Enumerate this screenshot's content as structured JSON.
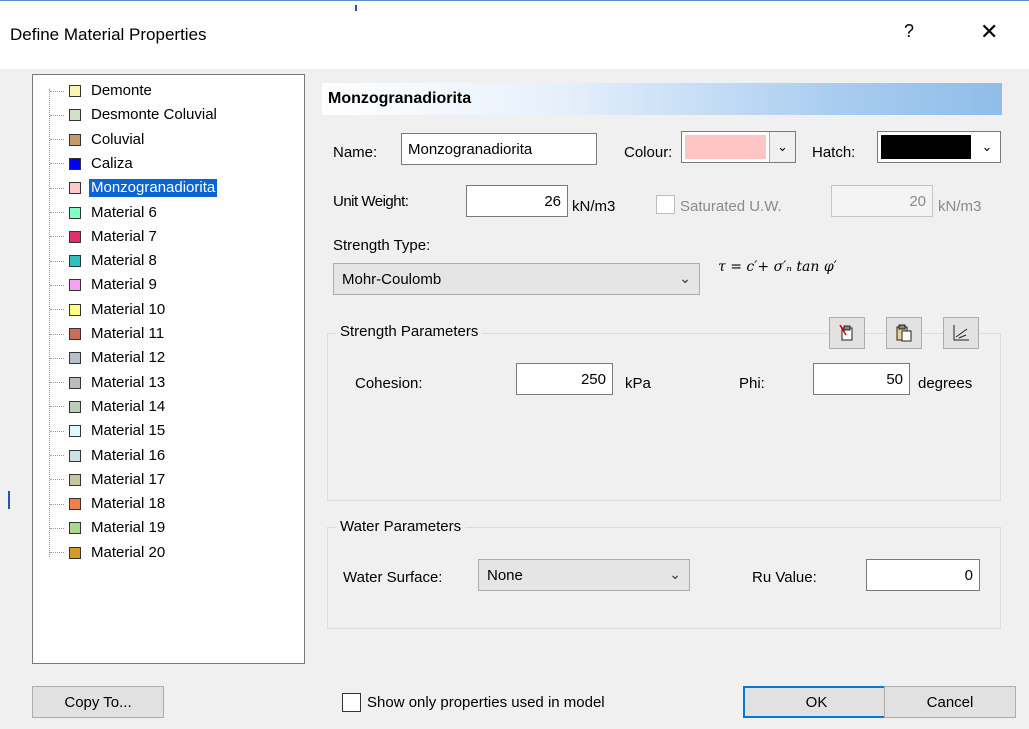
{
  "window": {
    "title": "Define Material Properties",
    "help_glyph": "?",
    "close_glyph": "✕"
  },
  "tree": {
    "items": [
      {
        "label": "Demonte",
        "color": "#fbf5b0"
      },
      {
        "label": "Desmonte Coluvial",
        "color": "#cde3c4"
      },
      {
        "label": "Coluvial",
        "color": "#c49a6c"
      },
      {
        "label": "Caliza",
        "color": "#0000ff"
      },
      {
        "label": "Monzogranadiorita",
        "color": "#ffc8c8",
        "selected": true
      },
      {
        "label": "Material 6",
        "color": "#80ffc0"
      },
      {
        "label": "Material 7",
        "color": "#e0306a"
      },
      {
        "label": "Material 8",
        "color": "#30c0c0"
      },
      {
        "label": "Material 9",
        "color": "#f3a3f3"
      },
      {
        "label": "Material 10",
        "color": "#ffff80"
      },
      {
        "label": "Material 11",
        "color": "#d06a5a"
      },
      {
        "label": "Material 12",
        "color": "#b8c0cc"
      },
      {
        "label": "Material 13",
        "color": "#bcbcbc"
      },
      {
        "label": "Material 14",
        "color": "#b8d0b8"
      },
      {
        "label": "Material 15",
        "color": "#e0f8ff"
      },
      {
        "label": "Material 16",
        "color": "#c8e4e4"
      },
      {
        "label": "Material 17",
        "color": "#c8c49c"
      },
      {
        "label": "Material 18",
        "color": "#f0804c"
      },
      {
        "label": "Material 19",
        "color": "#a8d890"
      },
      {
        "label": "Material 20",
        "color": "#d49a2c"
      }
    ]
  },
  "header": {
    "title": "Monzogranadiorita"
  },
  "form": {
    "name_label": "Name:",
    "name_value": "Monzogranadiorita",
    "colour_label": "Colour:",
    "colour_value": "#ffc4c4",
    "hatch_label": "Hatch:",
    "hatch_value": "#000000",
    "unit_weight_label": "Unit Weight:",
    "unit_weight_value": "26",
    "unit_weight_unit": "kN/m3",
    "saturated_label": "Saturated U.W.",
    "saturated_value": "20",
    "saturated_unit": "kN/m3",
    "strength_type_label": "Strength Type:",
    "strength_type_value": "Mohr-Coulomb",
    "formula": "τ = c′+ σ′ₙ tan φ′"
  },
  "strength": {
    "group_title": "Strength Parameters",
    "cohesion_label": "Cohesion:",
    "cohesion_value": "250",
    "cohesion_unit": "kPa",
    "phi_label": "Phi:",
    "phi_value": "50",
    "phi_unit": "degrees",
    "icons": [
      "clipboard-copy-icon",
      "clipboard-paste-icon",
      "graph-icon"
    ]
  },
  "water": {
    "group_title": "Water Parameters",
    "surface_label": "Water Surface:",
    "surface_value": "None",
    "ru_label": "Ru Value:",
    "ru_value": "0"
  },
  "footer": {
    "copy_to": "Copy To...",
    "show_only_label": "Show only properties used in model",
    "ok": "OK",
    "cancel": "Cancel"
  }
}
